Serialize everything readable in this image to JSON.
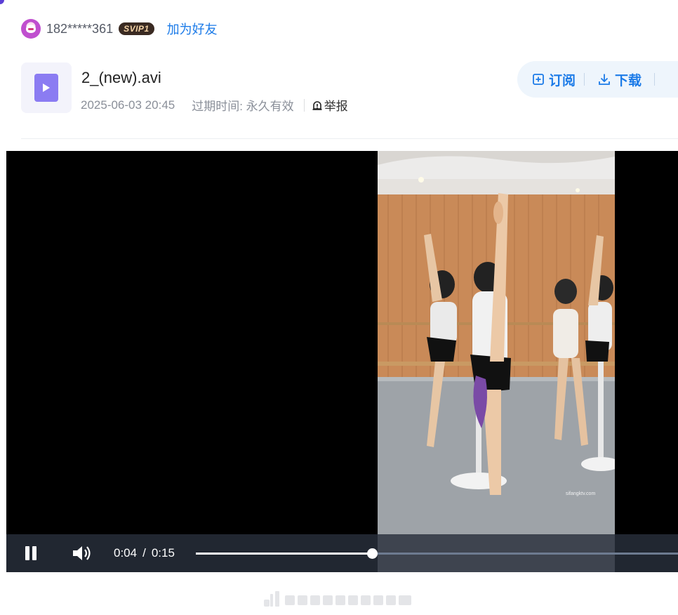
{
  "user": {
    "id": "182*****361",
    "vip_label": "SVIP1",
    "add_friend_label": "加为好友"
  },
  "file": {
    "name": "2_(new).avi",
    "date": "2025-06-03 20:45",
    "expire_label": "过期时间: 永久有效",
    "report_label": "举报"
  },
  "actions": {
    "subscribe_label": "订阅",
    "download_label": "下载"
  },
  "player": {
    "current_time": "0:04",
    "separator": "/",
    "duration": "0:15",
    "progress_fraction": 0.365,
    "state": "playing",
    "watermark": "sifangktv.com"
  },
  "colors": {
    "accent": "#1c7be8",
    "vip_bg": "#3a2a22",
    "file_icon": "#8b7cf2",
    "action_bg": "#eef5fc"
  },
  "icons": {
    "avatar": "avatar-cat-icon",
    "file": "video-file-icon",
    "report": "alarm-icon",
    "subscribe": "subscribe-icon",
    "download": "download-icon",
    "pause": "pause-icon",
    "volume": "volume-icon"
  }
}
